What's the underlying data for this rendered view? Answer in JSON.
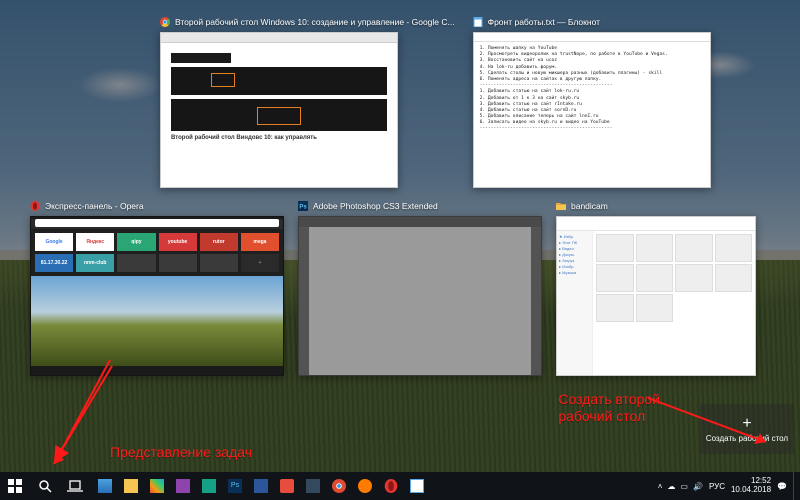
{
  "windows": {
    "chrome": {
      "title": "Второй рабочий стол Windows 10: создание и управление - Google C...",
      "heading": "Второй рабочий стол Виндовс 10: как управлять"
    },
    "notepad": {
      "title": "Фронт работы.txt — Блокнот",
      "lines": [
        "1. Поменять шапку на YouTube",
        "2. Просмотреть видеоролик на trustNope, по работе в YouTube и Vegas.",
        "3. Восстановить сайт на ucoz",
        "4. На lok-ru добавить форум.",
        "5. Сделать столы и новую микшера разных (добавить плагины) - skill",
        "6. Поменять адреса на сайтах в другую папку.",
        "------------------------------------------------",
        "1. Добавить статью на сайт lok-ru.ru",
        "2. Добавить от 1 к 3 на сайт skyb.ru",
        "3. Добавить статью на сайт rIntake.ru",
        "4. Добавить статью на сайт sornD.ru",
        "5. Добавить описание теперь на сайт lnnI.ru",
        "6. Записать видео на skyb.ru и видео на YouTube",
        "------------------------------------------------"
      ]
    },
    "opera": {
      "title": "Экспресс-панель - Opera",
      "tiles": [
        {
          "label": "Google",
          "bg": "#ffffff",
          "fg": "#3b7ded"
        },
        {
          "label": "Яндекс",
          "bg": "#ffffff",
          "fg": "#d63939"
        },
        {
          "label": "qipy",
          "bg": "#2aa574",
          "fg": "#fff"
        },
        {
          "label": "youtube",
          "bg": "#d63939",
          "fg": "#fff"
        },
        {
          "label": "rutor",
          "bg": "#c23a2e",
          "fg": "#fff"
        },
        {
          "label": "mega",
          "bg": "#e04f2e",
          "fg": "#fff"
        },
        {
          "label": "81.17.30.22",
          "bg": "#2a6fb5",
          "fg": "#fff"
        },
        {
          "label": "nnm-club",
          "bg": "#3aa0a8",
          "fg": "#fff"
        },
        {
          "label": "",
          "bg": "#3a3a3a",
          "fg": "#fff"
        },
        {
          "label": "",
          "bg": "#3a3a3a",
          "fg": "#fff"
        },
        {
          "label": "",
          "bg": "#3a3a3a",
          "fg": "#fff"
        },
        {
          "label": "+",
          "bg": "#2a2a2a",
          "fg": "#888"
        }
      ]
    },
    "photoshop": {
      "title": "Adobe Photoshop CS3 Extended"
    },
    "explorer": {
      "title": "bandicam"
    }
  },
  "newdesktop": {
    "label": "Создать рабочий стол"
  },
  "annotations": {
    "left": "Представление задач",
    "right": "Создать второй\nрабочий стол"
  },
  "taskbar": {
    "lang": "РУС",
    "time": "12:52",
    "date": "10.04.2018"
  }
}
